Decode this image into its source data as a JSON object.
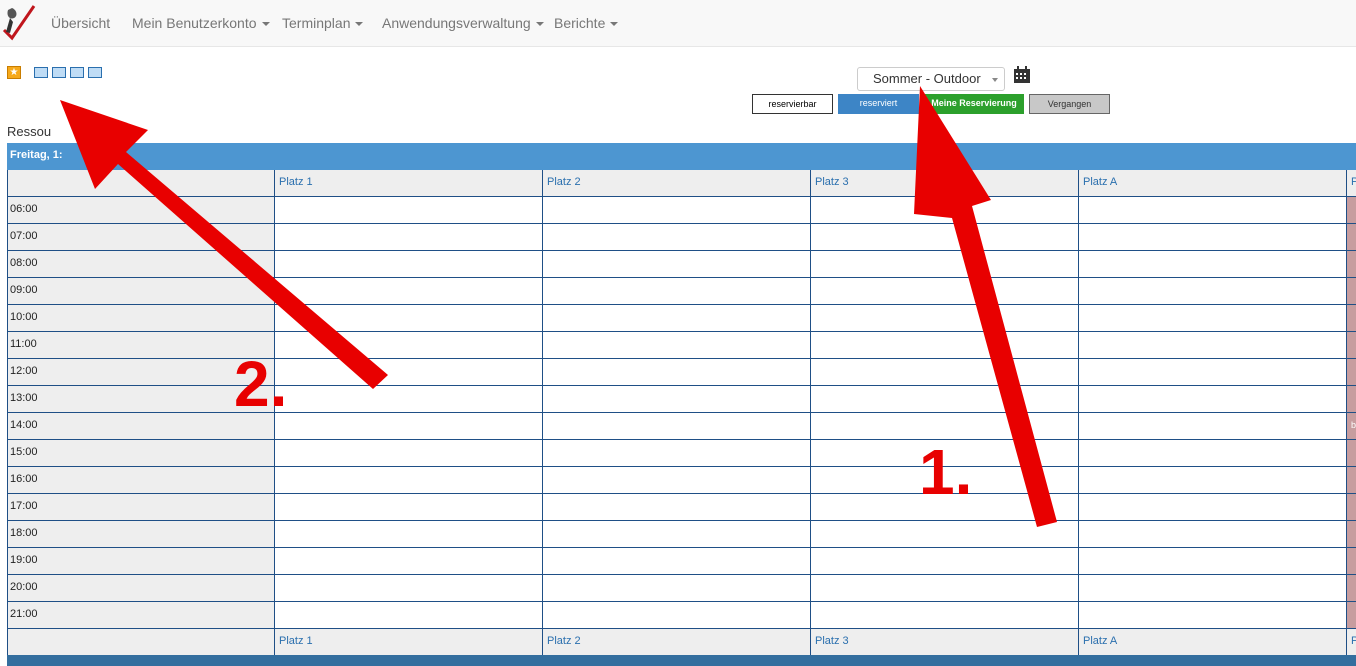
{
  "nav": {
    "items": [
      "Übersicht",
      "Mein Benutzerkonto",
      "Terminplan",
      "Anwendungsverwaltung",
      "Berichte"
    ]
  },
  "toolbar": {
    "schedule_selected": "Sommer - Outdoor"
  },
  "legend": {
    "reservable": "reservierbar",
    "reserved": "reserviert",
    "mine": "Meine Reservierung",
    "past": "Vergangen"
  },
  "resources_label": "Ressou",
  "day_header": "Freitag, 1:",
  "columns": [
    "Platz 1",
    "Platz 2",
    "Platz 3",
    "Platz A",
    "P"
  ],
  "times": [
    "06:00",
    "07:00",
    "08:00",
    "09:00",
    "10:00",
    "11:00",
    "12:00",
    "13:00",
    "14:00",
    "15:00",
    "16:00",
    "17:00",
    "18:00",
    "19:00",
    "20:00",
    "21:00"
  ],
  "blocked_label": "bi",
  "annotations": {
    "one": "1.",
    "two": "2."
  },
  "colors": {
    "primary": "#4d96d1",
    "reserved": "#3d85c6",
    "mine": "#2ca02c",
    "past": "#c8c8c8",
    "annotation": "#e80000"
  }
}
